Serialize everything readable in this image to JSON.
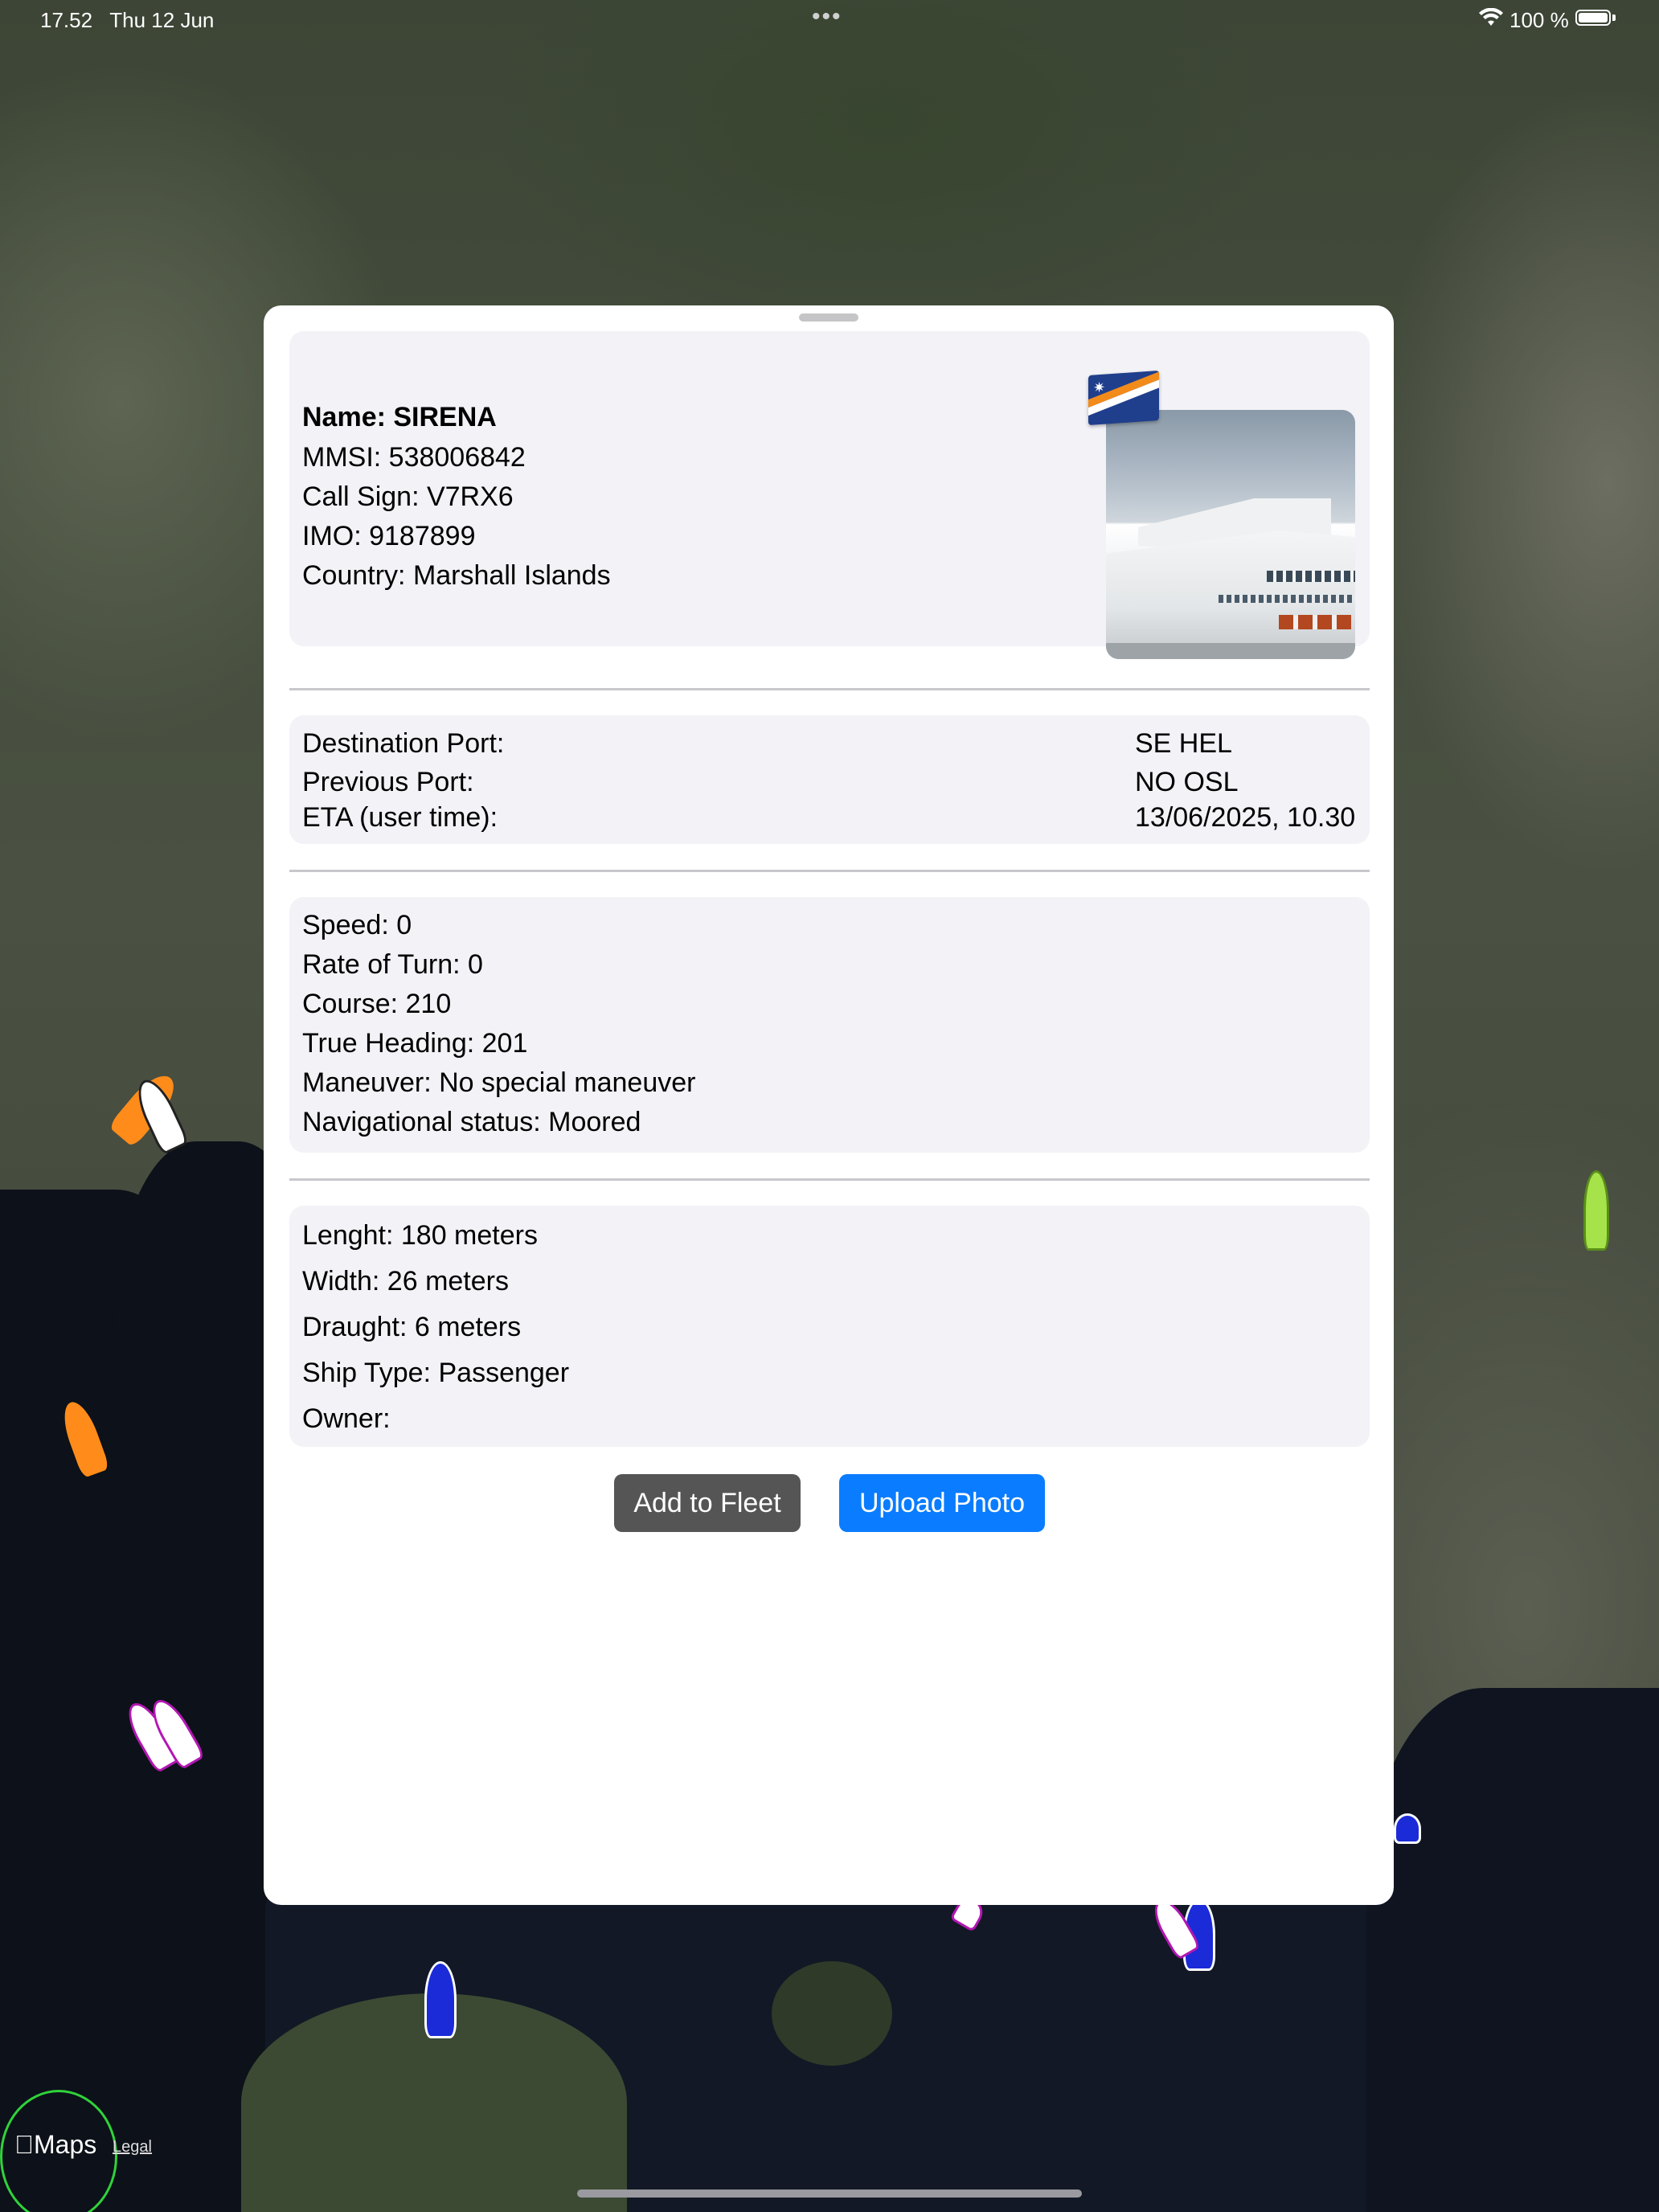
{
  "status_bar": {
    "time": "17.52",
    "date": "Thu 12 Jun",
    "more_dots": "•••",
    "battery_percent": "100 %",
    "battery_level": 1.0
  },
  "vessel_identity": {
    "name_line": "Name: SIRENA",
    "mmsi_line": "MMSI: 538006842",
    "call_sign_line": "Call Sign: V7RX6",
    "imo_line": "IMO: 9187899",
    "country_line": "Country: Marshall Islands",
    "flag_icon": "marshall-islands-flag",
    "photo_subject": "cruise-ship-photo"
  },
  "voyage": {
    "destination_label": "Destination Port:",
    "destination_value": "SE HEL",
    "previous_label": "Previous Port:",
    "previous_value": "NO OSL",
    "eta_label": "ETA (user time):",
    "eta_value": "13/06/2025, 10.30"
  },
  "navigation": {
    "speed": "Speed: 0",
    "rate_of_turn": "Rate of Turn: 0",
    "course": "Course: 210",
    "true_heading": "True Heading: 201",
    "maneuver": "Maneuver: No special maneuver",
    "nav_status": "Navigational status: Moored"
  },
  "dimensions": {
    "length": "Lenght: 180 meters",
    "width": "Width: 26 meters",
    "draught": "Draught: 6 meters",
    "ship_type": "Ship Type: Passenger",
    "owner": "Owner:"
  },
  "actions": {
    "add_to_fleet": "Add to Fleet",
    "upload_photo": "Upload Photo"
  },
  "map": {
    "attribution_logo": "Maps",
    "legal_link": "Legal"
  },
  "colors": {
    "accent_blue": "#0a7cff",
    "fleet_button_gray": "#555555",
    "card_background": "#f2f2f7"
  }
}
